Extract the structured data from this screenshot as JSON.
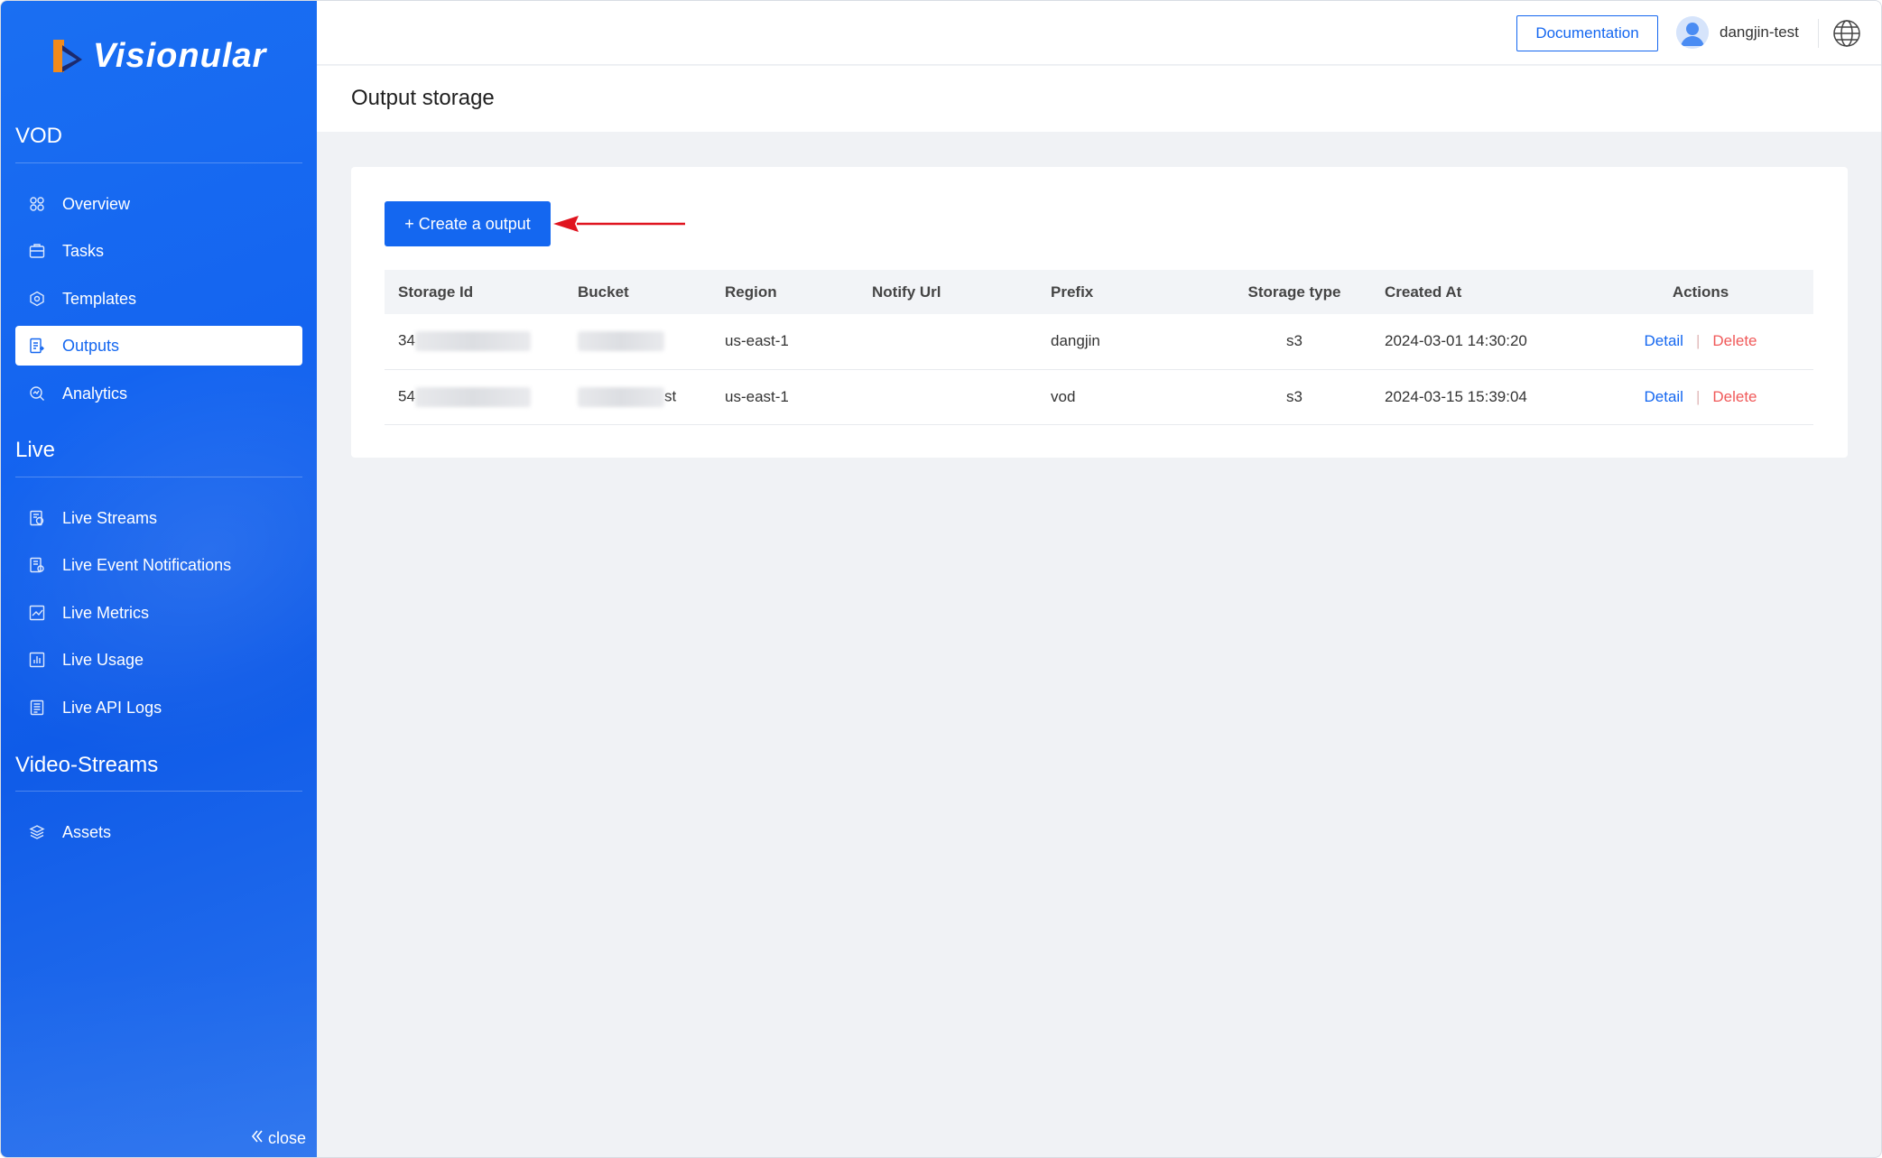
{
  "brand": {
    "name": "Visionular"
  },
  "sidebar": {
    "sections": [
      {
        "title": "VOD"
      },
      {
        "title": "Live"
      },
      {
        "title": "Video-Streams"
      }
    ],
    "items": [
      {
        "label": "Overview",
        "icon": "overview-icon"
      },
      {
        "label": "Tasks",
        "icon": "tasks-icon"
      },
      {
        "label": "Templates",
        "icon": "templates-icon"
      },
      {
        "label": "Outputs",
        "icon": "outputs-icon",
        "active": true
      },
      {
        "label": "Analytics",
        "icon": "analytics-icon"
      },
      {
        "label": "Live Streams",
        "icon": "live-streams-icon"
      },
      {
        "label": "Live Event Notifications",
        "icon": "notifications-icon"
      },
      {
        "label": "Live Metrics",
        "icon": "metrics-icon"
      },
      {
        "label": "Live Usage",
        "icon": "usage-icon"
      },
      {
        "label": "Live API Logs",
        "icon": "api-logs-icon"
      },
      {
        "label": "Assets",
        "icon": "assets-icon"
      }
    ],
    "close_label": "close"
  },
  "header": {
    "documentation_label": "Documentation",
    "username": "dangjin-test"
  },
  "page": {
    "title": "Output storage",
    "create_button_label": "+ Create a output"
  },
  "table": {
    "columns": [
      "Storage Id",
      "Bucket",
      "Region",
      "Notify Url",
      "Prefix",
      "Storage type",
      "Created At",
      "Actions"
    ],
    "rows": [
      {
        "storage_id_visible": "34",
        "bucket_visible": "",
        "region": "us-east-1",
        "notify_url": "",
        "prefix": "dangjin",
        "storage_type": "s3",
        "created_at": "2024-03-01 14:30:20",
        "detail_label": "Detail",
        "delete_label": "Delete"
      },
      {
        "storage_id_visible": "54",
        "bucket_visible": "st",
        "region": "us-east-1",
        "notify_url": "",
        "prefix": "vod",
        "storage_type": "s3",
        "created_at": "2024-03-15 15:39:04",
        "detail_label": "Detail",
        "delete_label": "Delete"
      }
    ]
  },
  "colors": {
    "primary": "#1467f0",
    "delete": "#f05a5a",
    "annotation_arrow": "#e0141f"
  }
}
